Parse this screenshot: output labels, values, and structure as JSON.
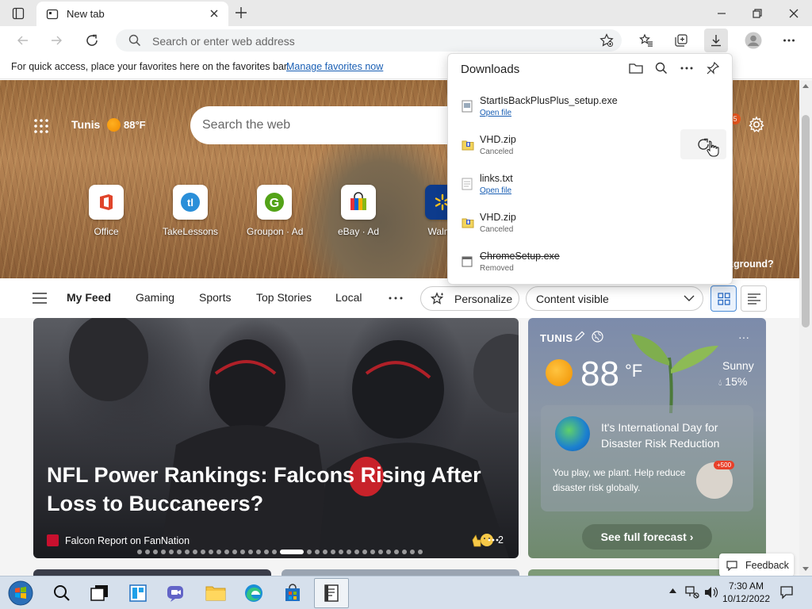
{
  "browser": {
    "tab_title": "New tab",
    "address_placeholder": "Search or enter web address"
  },
  "favorites_bar": {
    "text": "For quick access, place your favorites here on the favorites bar.",
    "link": "Manage favorites now"
  },
  "hero": {
    "city": "Tunis",
    "temp": "88°F",
    "search_placeholder": "Search the web",
    "notification_count": "5",
    "background_question": "kground?",
    "quick_links": [
      {
        "label": "Office"
      },
      {
        "label": "TakeLessons"
      },
      {
        "label": "Groupon · Ad"
      },
      {
        "label": "eBay · Ad"
      },
      {
        "label": "Walma"
      }
    ]
  },
  "feed_nav": {
    "items": [
      "My Feed",
      "Gaming",
      "Sports",
      "Top Stories",
      "Local"
    ],
    "personalize": "Personalize",
    "content_visible": "Content visible"
  },
  "main_card": {
    "headline": "NFL Power Rankings: Falcons Rising After Loss to Buccaneers?",
    "source": "Falcon Report on FanNation",
    "reaction_count": "2"
  },
  "weather_card": {
    "city": "TUNIS",
    "temp": "88",
    "unit": "°F",
    "condition": "Sunny",
    "precip": "15%",
    "promo_title": "It's International Day for Disaster Risk Reduction",
    "promo_text": "You play, we plant. Help reduce disaster risk globally.",
    "promo_badge": "+500",
    "forecast_button": "See full forecast"
  },
  "feedback": "Feedback",
  "downloads": {
    "title": "Downloads",
    "items": [
      {
        "name": "StartIsBackPlusPlus_setup.exe",
        "status": "Open file"
      },
      {
        "name": "VHD.zip",
        "status": "Canceled"
      },
      {
        "name": "links.txt",
        "status": "Open file"
      },
      {
        "name": "VHD.zip",
        "status": "Canceled"
      },
      {
        "name": "ChromeSetup.exe",
        "status": "Removed"
      }
    ]
  },
  "taskbar": {
    "time": "7:30 AM",
    "date": "10/12/2022"
  }
}
